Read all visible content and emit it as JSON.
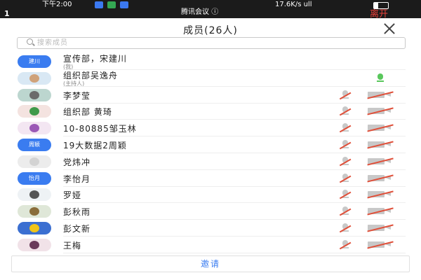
{
  "status_bar": {
    "time": "下午2:00",
    "network": "17.6K/s",
    "signal": "ull",
    "battery_level": 0.3,
    "app_icon_colors": [
      "#3b79f0",
      "#34a853",
      "#3b79f0"
    ]
  },
  "meeting_bar": {
    "title": "腾讯会议",
    "info_icon": "ⓘ",
    "leave_label": "离开",
    "left_mark": "1"
  },
  "panel": {
    "title": "成员(26人)",
    "close_icon": "close-icon"
  },
  "search": {
    "placeholder": "搜索成员"
  },
  "members": [
    {
      "name": "宣传部，宋建川",
      "role": "(我)",
      "avatar_text": "建川",
      "mic": "none",
      "cam": "none"
    },
    {
      "name": "组织部吴逸舟",
      "role": "(主持人)",
      "avatar_colors": [
        "#d9e8f4",
        "#cfa27a"
      ],
      "mic": "on",
      "cam": "none"
    },
    {
      "name": "李梦莹",
      "avatar_colors": [
        "#bcd6cf",
        "#6b6b6b"
      ],
      "mic": "muted",
      "cam": "off"
    },
    {
      "name": " 组织部 黄琦",
      "avatar_colors": [
        "#f4e3e0",
        "#3f9a4a"
      ],
      "mic": "muted",
      "cam": "off"
    },
    {
      "name": "10-80885邹玉林",
      "avatar_colors": [
        "#f3e6f2",
        "#9b59b6"
      ],
      "mic": "muted",
      "cam": "off"
    },
    {
      "name": "19大数据2周颖",
      "avatar_text": "周颖",
      "mic": "muted",
      "cam": "off"
    },
    {
      "name": "党炜冲",
      "avatar_colors": [
        "#ececec",
        "#d3d3d3"
      ],
      "mic": "muted",
      "cam": "off"
    },
    {
      "name": "李怡月",
      "avatar_text": "怡月",
      "mic": "muted",
      "cam": "off"
    },
    {
      "name": "罗娅",
      "avatar_colors": [
        "#eef2f5",
        "#555555"
      ],
      "mic": "muted",
      "cam": "off"
    },
    {
      "name": "彭秋雨",
      "avatar_colors": [
        "#dfe7d8",
        "#8a6d3b"
      ],
      "mic": "muted",
      "cam": "off"
    },
    {
      "name": "彭文新",
      "avatar_colors": [
        "#3b6fd1",
        "#f0c419"
      ],
      "mic": "muted",
      "cam": "off"
    },
    {
      "name": "王梅",
      "avatar_colors": [
        "#f1e2e8",
        "#6a3a5a"
      ],
      "mic": "muted",
      "cam": "off"
    }
  ],
  "invite_label": "邀请",
  "colors": {
    "accent": "#3a7cf0",
    "danger": "#e0503a",
    "mic_on": "#59c75c",
    "leave": "#e8403a"
  }
}
